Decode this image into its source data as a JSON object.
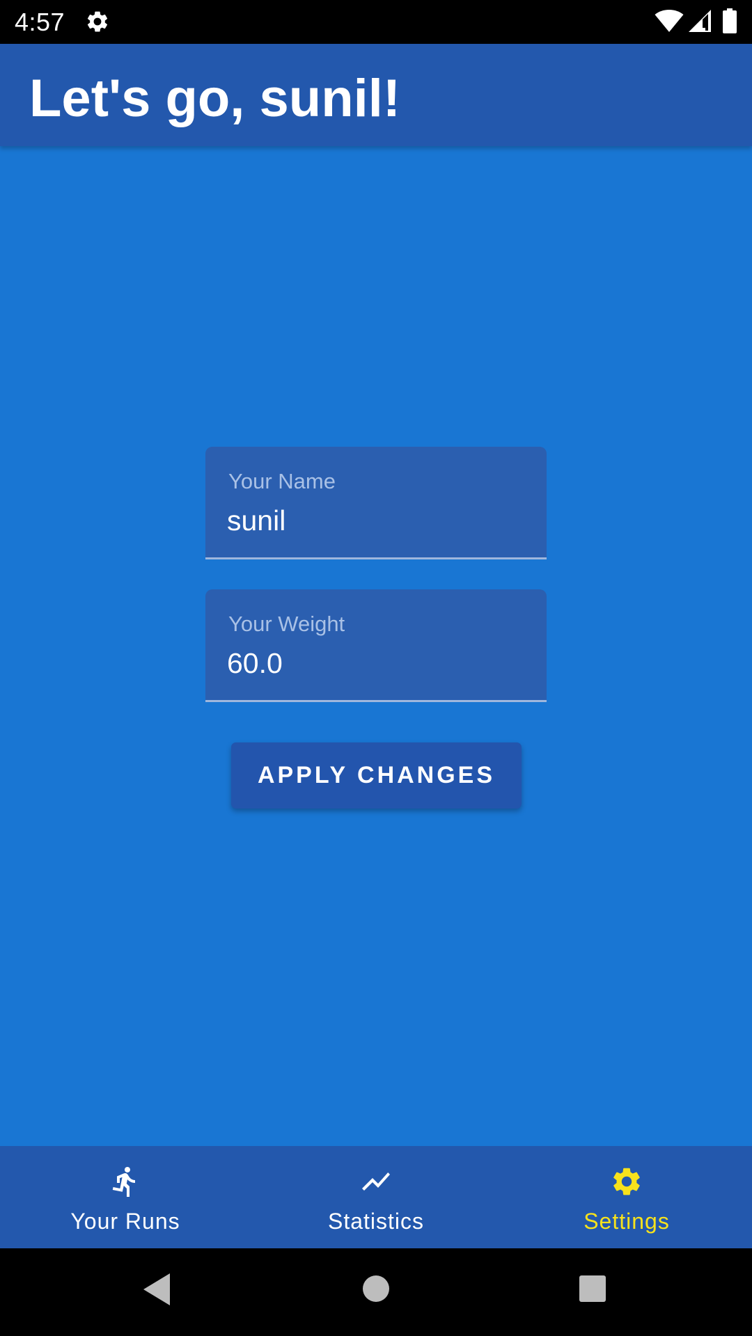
{
  "status_bar": {
    "time": "4:57",
    "icons": [
      "settings-gear-icon",
      "wifi-icon",
      "cell-signal-icon",
      "battery-icon"
    ]
  },
  "app_bar": {
    "title": "Let's go, sunil!"
  },
  "form": {
    "name_label": "Your Name",
    "name_value": "sunil",
    "weight_label": "Your Weight",
    "weight_value": "60.0",
    "apply_label": "APPLY CHANGES"
  },
  "bottom_nav": {
    "items": [
      {
        "label": "Your Runs",
        "icon": "running-person-icon",
        "active": false
      },
      {
        "label": "Statistics",
        "icon": "trending-line-icon",
        "active": false
      },
      {
        "label": "Settings",
        "icon": "settings-gear-icon",
        "active": true
      }
    ]
  },
  "colors": {
    "app_bar": "#2358ad",
    "content_background": "#1976d3",
    "field_background": "#2b5fb0",
    "button_background": "#2355ad",
    "active_nav": "#f7e21c",
    "inactive_nav": "#ffffff"
  },
  "system_nav": {
    "icons": [
      "back-triangle-icon",
      "home-circle-icon",
      "recents-square-icon"
    ]
  }
}
